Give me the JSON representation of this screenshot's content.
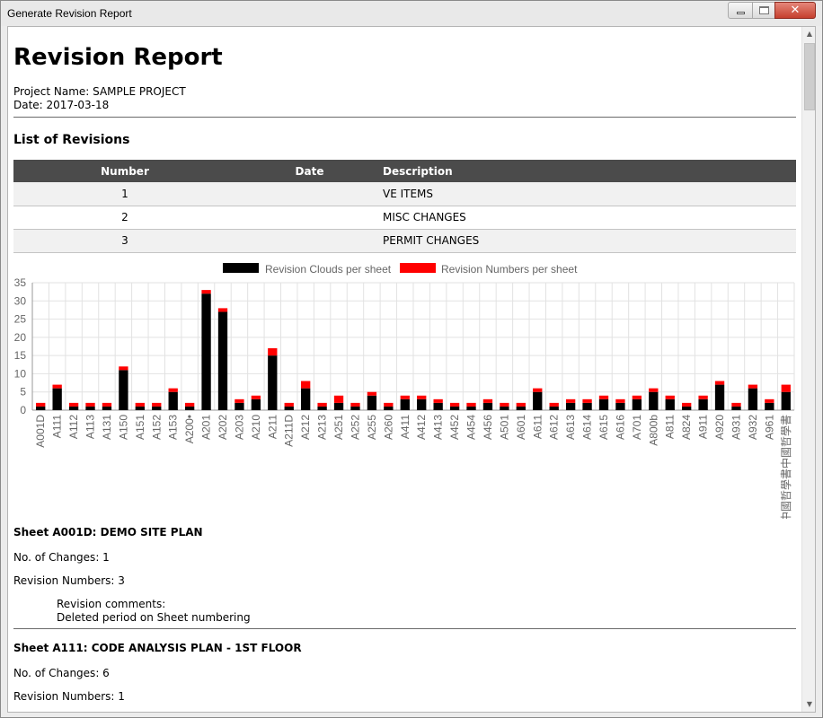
{
  "window": {
    "title": "Generate Revision Report",
    "close_glyph": "✕"
  },
  "report": {
    "title": "Revision Report",
    "project_line": "Project Name: SAMPLE PROJECT",
    "date_line": "Date: 2017-03-18",
    "list_heading": "List of Revisions",
    "table": {
      "headers": [
        "Number",
        "Date",
        "Description"
      ],
      "rows": [
        {
          "number": "1",
          "date": "",
          "description": "VE ITEMS"
        },
        {
          "number": "2",
          "date": "",
          "description": "MISC CHANGES"
        },
        {
          "number": "3",
          "date": "",
          "description": "PERMIT CHANGES"
        }
      ]
    }
  },
  "chart_data": {
    "type": "bar",
    "stacked": true,
    "categories": [
      "A001D",
      "A111",
      "A112",
      "A113",
      "A131",
      "A150",
      "A151",
      "A152",
      "A153",
      "A200•",
      "A201",
      "A202",
      "A203",
      "A210",
      "A211",
      "A211D",
      "A212",
      "A213",
      "A251",
      "A252",
      "A255",
      "A260",
      "A411",
      "A412",
      "A413",
      "A452",
      "A454",
      "A456",
      "A501",
      "A601",
      "A611",
      "A612",
      "A613",
      "A614",
      "A615",
      "A616",
      "A701",
      "A800b",
      "A811",
      "A824",
      "A911",
      "A920",
      "A931",
      "A932",
      "A961",
      "中國哲學書中國哲學書"
    ],
    "series": [
      {
        "name": "Revision Clouds per sheet",
        "color": "#000000",
        "values": [
          1,
          6,
          1,
          1,
          1,
          11,
          1,
          1,
          5,
          1,
          32,
          27,
          2,
          3,
          15,
          1,
          6,
          1,
          2,
          1,
          4,
          1,
          3,
          3,
          2,
          1,
          1,
          2,
          1,
          1,
          5,
          1,
          2,
          2,
          3,
          2,
          3,
          5,
          3,
          1,
          3,
          7,
          1,
          6,
          2,
          5
        ]
      },
      {
        "name": "Revision Numbers per sheet",
        "color": "#ff0000",
        "values": [
          1,
          1,
          1,
          1,
          1,
          1,
          1,
          1,
          1,
          1,
          1,
          1,
          1,
          1,
          2,
          1,
          2,
          1,
          2,
          1,
          1,
          1,
          1,
          1,
          1,
          1,
          1,
          1,
          1,
          1,
          1,
          1,
          1,
          1,
          1,
          1,
          1,
          1,
          1,
          1,
          1,
          1,
          1,
          1,
          1,
          2
        ]
      }
    ],
    "ylim": [
      0,
      35
    ],
    "yticks": [
      0,
      5,
      10,
      15,
      20,
      25,
      30,
      35
    ],
    "grid": true,
    "legend_position": "top"
  },
  "sheets": [
    {
      "heading": "Sheet A001D: DEMO SITE PLAN",
      "changes": "No. of Changes: 1",
      "revision_numbers": "Revision Numbers: 3",
      "comments_label": "Revision comments:",
      "comment": "Deleted period on Sheet numbering"
    },
    {
      "heading": "Sheet A111: CODE ANALYSIS PLAN - 1ST FLOOR",
      "changes": "No. of Changes: 6",
      "revision_numbers": "Revision Numbers: 1"
    }
  ]
}
